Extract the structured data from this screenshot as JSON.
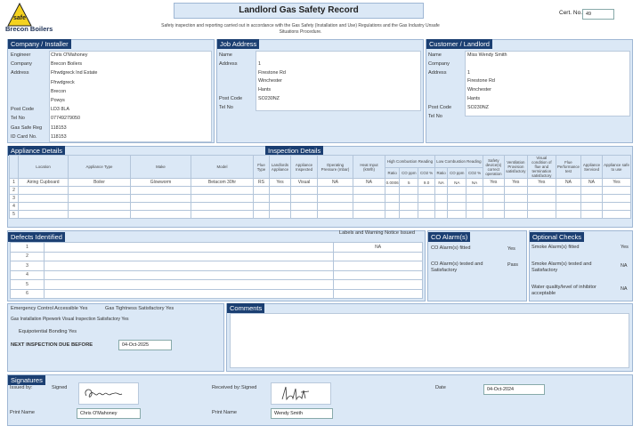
{
  "logo": {
    "word": "safe",
    "brand": "Brecon Boilers"
  },
  "title": "Landlord Gas Safety Record",
  "subtitle": "Safety inspection and reporting carried out in accordance with the Gas Safety (Installation and Use) Regulations and the Gas Industry Unsafe Situations Procedure.",
  "cert": {
    "label": "Cert. No.",
    "value": "49"
  },
  "company": {
    "header": "Company / Installer",
    "fields": [
      {
        "label": "Engineer",
        "value": "Chris O'Mahoney"
      },
      {
        "label": "Company",
        "value": "Brecon Boilers"
      },
      {
        "label": "Address",
        "value": "Ffrwdgreck Ind Estate"
      },
      {
        "label": "",
        "value": "Ffrwdgreck"
      },
      {
        "label": "",
        "value": "Brecon"
      },
      {
        "label": "",
        "value": "Powys"
      },
      {
        "label": "Post Code",
        "value": "LD3 8LA"
      },
      {
        "label": "Tel No",
        "value": "07749279050"
      },
      {
        "label": "Gas Safe Reg",
        "value": "118153"
      },
      {
        "label": "ID Card No.",
        "value": "118153"
      }
    ]
  },
  "job": {
    "header": "Job Address",
    "fields": [
      {
        "label": "Name",
        "value": ""
      },
      {
        "label": "Address",
        "value": "1"
      },
      {
        "label": "",
        "value": "Firestone Rd"
      },
      {
        "label": "",
        "value": "Winchester"
      },
      {
        "label": "",
        "value": "Hants"
      },
      {
        "label": "Post Code",
        "value": "SO230NZ"
      },
      {
        "label": "Tel No",
        "value": ""
      }
    ]
  },
  "landlord": {
    "header": "Customer / Landlord",
    "fields": [
      {
        "label": "Name",
        "value": "Miss Wendy Smith"
      },
      {
        "label": "Company",
        "value": ""
      },
      {
        "label": "Address",
        "value": "1"
      },
      {
        "label": "",
        "value": "Firestone Rd"
      },
      {
        "label": "",
        "value": "Winchester"
      },
      {
        "label": "",
        "value": "Hants"
      },
      {
        "label": "Post Code",
        "value": "SO230NZ"
      },
      {
        "label": "Tel No",
        "value": ""
      }
    ]
  },
  "appliance": {
    "header": "Appliance Details",
    "inspection_header": "Inspection Details",
    "columns": [
      "Location",
      "Appliance Type",
      "Make",
      "Model",
      "Flue Type",
      "Landlords Appliance",
      "Appliance Inspected",
      "Operating Pressure (mbar)",
      "Heat Input (kW/h)",
      "High Combustion Reading",
      "Low Combustion Reading",
      "Safety device(s) correct operation",
      "Ventilation Provision satisfactory",
      "Visual condition of flue and termination satisfactory",
      "Flue Performance test",
      "Appliance Serviced",
      "Appliance safe to use"
    ],
    "sub_cols": [
      "Ratio",
      "CO ppm",
      "CO2 %",
      "Ratio",
      "CO ppm",
      "CO2 %"
    ],
    "rows": [
      {
        "n": "1",
        "cells": [
          "Airing Cupboard",
          "Boiler",
          "Glowworm",
          "Betacom 30hr",
          "RS",
          "Yes",
          "Visual",
          "NA",
          "NA"
        ],
        "comb": [
          "0.0006",
          "5",
          "9.0",
          "NA",
          "NA",
          "NA"
        ],
        "checks": [
          "Yes",
          "Yes",
          "Yes",
          "NA",
          "NA",
          "Yes"
        ]
      },
      {
        "n": "2",
        "cells": [],
        "comb": [],
        "checks": []
      },
      {
        "n": "3",
        "cells": [],
        "comb": [],
        "checks": []
      },
      {
        "n": "4",
        "cells": [],
        "comb": [],
        "checks": []
      },
      {
        "n": "5",
        "cells": [],
        "comb": [],
        "checks": []
      }
    ]
  },
  "defects": {
    "header": "Defects Identified",
    "label_col": "Labels and Warning Notice Issued",
    "rows": [
      {
        "n": "1",
        "text": "",
        "notice": "NA"
      },
      {
        "n": "2",
        "text": "",
        "notice": ""
      },
      {
        "n": "3",
        "text": "",
        "notice": ""
      },
      {
        "n": "4",
        "text": "",
        "notice": ""
      },
      {
        "n": "5",
        "text": "",
        "notice": ""
      },
      {
        "n": "6",
        "text": "",
        "notice": ""
      }
    ]
  },
  "co": {
    "header": "CO Alarm(s)",
    "items": [
      {
        "label": "CO Alarm(s) fitted",
        "value": "Yes"
      },
      {
        "label": "CO Alarm(s) tested and Satisfactory",
        "value": "Pass"
      }
    ]
  },
  "optional": {
    "header": "Optional Checks",
    "items": [
      {
        "label": "Smoke Alarm(s) fitted",
        "value": "Yes"
      },
      {
        "label": "Smoke Alarm(s) tested and Satisfactory",
        "value": "NA"
      },
      {
        "label": "Water quality/level of inhibitor acceptable",
        "value": "NA"
      }
    ]
  },
  "checks": {
    "ecv": "Emergency Control Accessible Yes",
    "tight": "Gas Tightness Satisfactory Yes",
    "pipe": "Gas Installation Pipework Visual Inspection Satisfactory Yes",
    "bond": "Equipotential Bonding Yes",
    "next_label": "NEXT INSPECTION DUE BEFORE",
    "next_value": "04-Oct-2025"
  },
  "comments": {
    "header": "Comments",
    "value": ""
  },
  "signatures": {
    "header": "Signatures",
    "issued_by": "Issued by:",
    "signed": "Signed",
    "received_by": "Received by:",
    "received_signed": "Signed",
    "date_label": "Date",
    "date_value": "04-Oct-2024",
    "print_label": "Print Name",
    "issuer_name": "Chris O'Mahoney",
    "print_label2": "Print Name",
    "receiver_name": "Wendy Smith"
  }
}
